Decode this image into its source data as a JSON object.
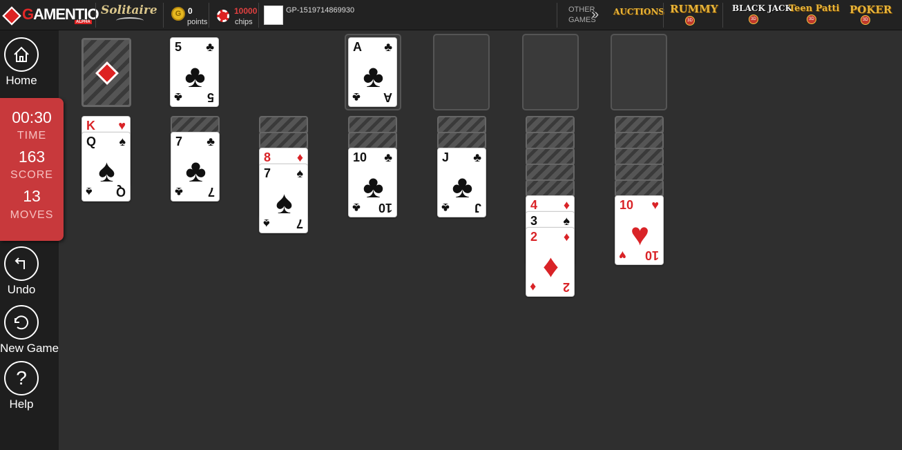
{
  "header": {
    "brand": "GAMENTIO",
    "brand_sub": "ALPHA",
    "game_title": "Solitaire",
    "points_value": "0",
    "points_label": "points",
    "chips_value": "10000",
    "chips_label": "chips",
    "user_id": "GP-1519714869930",
    "other_games_l1": "OTHER",
    "other_games_l2": "GAMES",
    "games": [
      "AUCTIONS",
      "RUMMY",
      "BLACK JACK",
      "Teen Patti",
      "POKER"
    ],
    "games_badge": "3D"
  },
  "sidebar": {
    "home": "Home",
    "undo": "Undo",
    "new_game": "New Game",
    "help": "Help"
  },
  "score": {
    "time": "00:30",
    "time_label": "TIME",
    "score": "163",
    "score_label": "SCORE",
    "moves": "13",
    "moves_label": "MOVES"
  },
  "colors": {
    "accent": "#c8393c",
    "table": "#2f2f2f",
    "red_suit": "#d92327"
  },
  "waste": {
    "rank": "5",
    "suit": "♣",
    "color": "blk"
  },
  "foundations": [
    {
      "rank": "A",
      "suit": "♣",
      "color": "blk"
    },
    null,
    null,
    null
  ],
  "tableau": [
    {
      "facedown": 0,
      "cards": [
        {
          "rank": "K",
          "suit": "♥",
          "color": "red"
        },
        {
          "rank": "Q",
          "suit": "♠",
          "color": "blk"
        }
      ]
    },
    {
      "facedown": 1,
      "cards": [
        {
          "rank": "7",
          "suit": "♣",
          "color": "blk"
        }
      ]
    },
    {
      "facedown": 2,
      "cards": [
        {
          "rank": "8",
          "suit": "♦",
          "color": "red"
        },
        {
          "rank": "7",
          "suit": "♠",
          "color": "blk"
        }
      ]
    },
    {
      "facedown": 2,
      "cards": [
        {
          "rank": "10",
          "suit": "♣",
          "color": "blk"
        }
      ]
    },
    {
      "facedown": 2,
      "cards": [
        {
          "rank": "J",
          "suit": "♣",
          "color": "blk"
        }
      ]
    },
    {
      "facedown": 5,
      "cards": [
        {
          "rank": "4",
          "suit": "♦",
          "color": "red"
        },
        {
          "rank": "3",
          "suit": "♠",
          "color": "blk"
        },
        {
          "rank": "2",
          "suit": "♦",
          "color": "red"
        }
      ]
    },
    {
      "facedown": 5,
      "cards": [
        {
          "rank": "10",
          "suit": "♥",
          "color": "red"
        }
      ]
    }
  ]
}
